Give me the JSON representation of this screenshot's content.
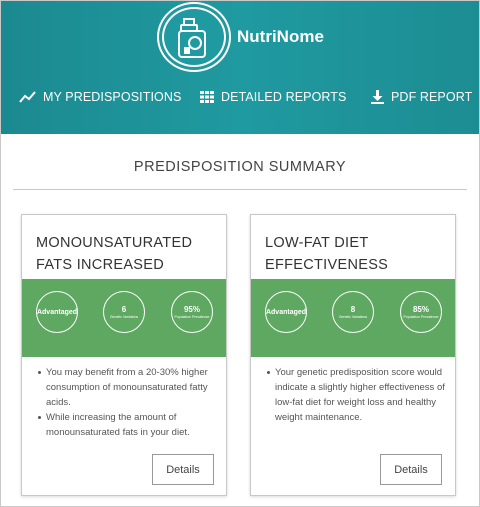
{
  "header": {
    "brand": "NutriNome",
    "logo_icon": "jar-icon",
    "nav": [
      {
        "label": "MY PREDISPOSITIONS",
        "icon": "trend-line-icon"
      },
      {
        "label": "DETAILED REPORTS",
        "icon": "grid-icon"
      },
      {
        "label": "PDF REPORT",
        "icon": "download-icon"
      }
    ]
  },
  "main": {
    "section_title": "PREDISPOSITION SUMMARY",
    "cards": [
      {
        "title_line1": "MONOUNSATURATED",
        "title_line2": "FATS INCREASED",
        "status": "Advantaged",
        "variants": "6",
        "variants_label": "Genetic Variations",
        "population": "95%",
        "population_label": "Population Prevalence",
        "bullets": [
          "You may benefit from a 20-30% higher consumption of monounsaturated fatty acids.",
          "While increasing the amount of monounsaturated fats in your diet."
        ],
        "button": "Details"
      },
      {
        "title_line1": "LOW-FAT DIET",
        "title_line2": "EFFECTIVENESS",
        "status": "Advantaged",
        "variants": "8",
        "variants_label": "Genetic Variations",
        "population": "85%",
        "population_label": "Population Prevalence",
        "bullets": [
          "Your genetic predisposition score would indicate a slightly higher effectiveness of low-fat diet for weight loss and healthy weight maintenance."
        ],
        "button": "Details"
      }
    ]
  },
  "colors": {
    "header": "#1f9aa0",
    "band": "#5fa862"
  }
}
